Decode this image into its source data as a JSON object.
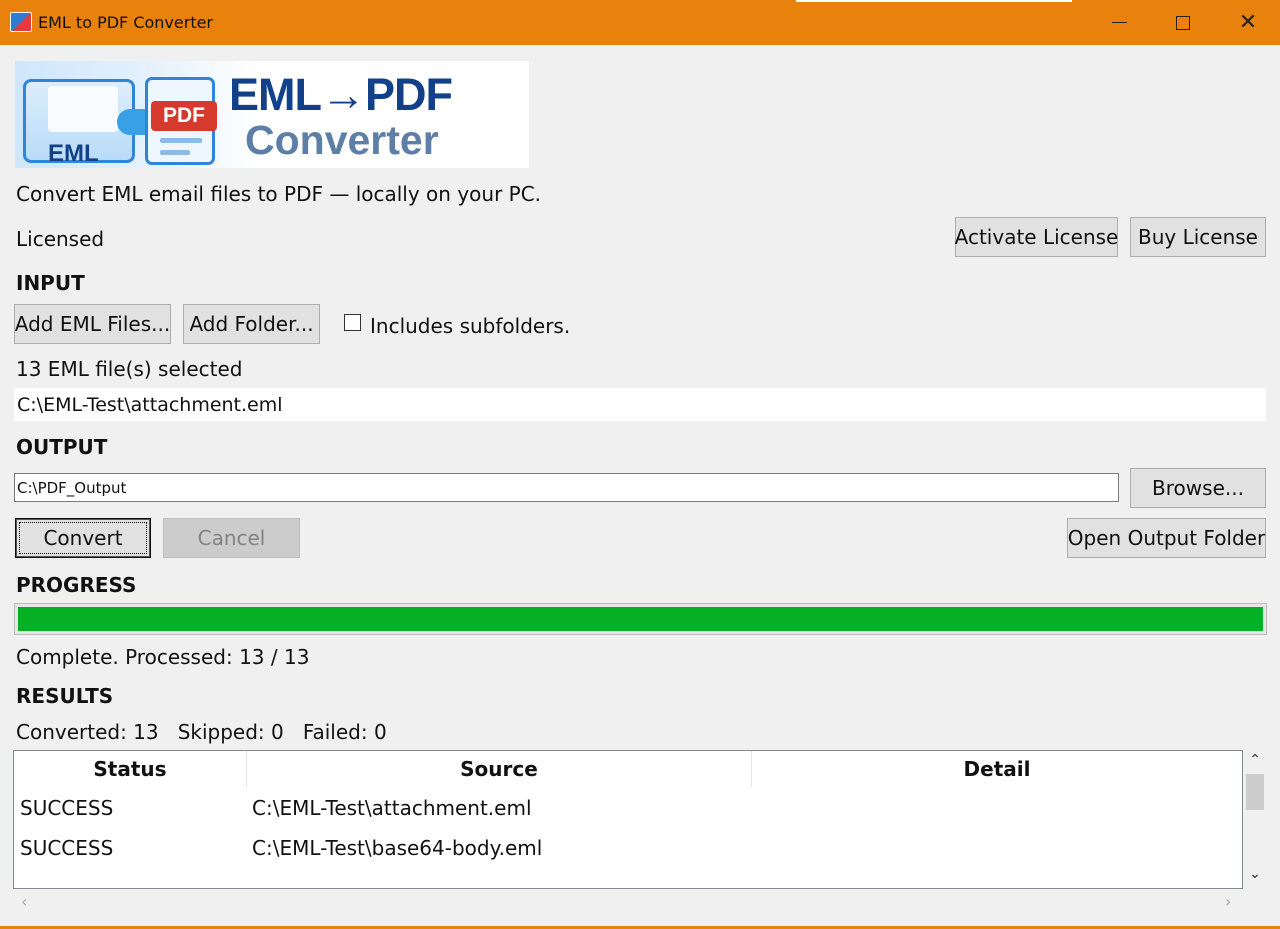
{
  "window": {
    "title": "EML to PDF Converter",
    "icon": "app-icon",
    "accent_color": "#e8820c"
  },
  "banner": {
    "line1": "EML→PDF",
    "line2": "Converter",
    "eml_badge": "EML",
    "pdf_badge": "PDF"
  },
  "header": {
    "tagline": "Convert EML email files to PDF — locally on your PC.",
    "license_status": "Licensed",
    "activate_label": "Activate License",
    "buy_label": "Buy License"
  },
  "input": {
    "section_title": "INPUT",
    "add_files_label": "Add EML Files...",
    "add_folder_label": "Add Folder...",
    "subfolders_label": "Includes subfolders.",
    "subfolders_checked": false,
    "selected_count": "13 EML file(s) selected",
    "current_file": "C:\\EML-Test\\attachment.eml"
  },
  "output": {
    "section_title": "OUTPUT",
    "path": "C:\\PDF_Output",
    "browse_label": "Browse..."
  },
  "actions": {
    "convert_label": "Convert",
    "cancel_label": "Cancel",
    "open_folder_label": "Open Output Folder"
  },
  "progress": {
    "section_title": "PROGRESS",
    "percent": 100,
    "bar_color": "#06b025",
    "status": "Complete. Processed: 13 / 13"
  },
  "results": {
    "section_title": "RESULTS",
    "summary": "Converted: 13   Skipped: 0   Failed: 0",
    "columns": [
      "Status",
      "Source",
      "Detail"
    ],
    "rows": [
      {
        "status": "SUCCESS",
        "source": "C:\\EML-Test\\attachment.eml",
        "detail": ""
      },
      {
        "status": "SUCCESS",
        "source": "C:\\EML-Test\\base64-body.eml",
        "detail": ""
      }
    ]
  }
}
